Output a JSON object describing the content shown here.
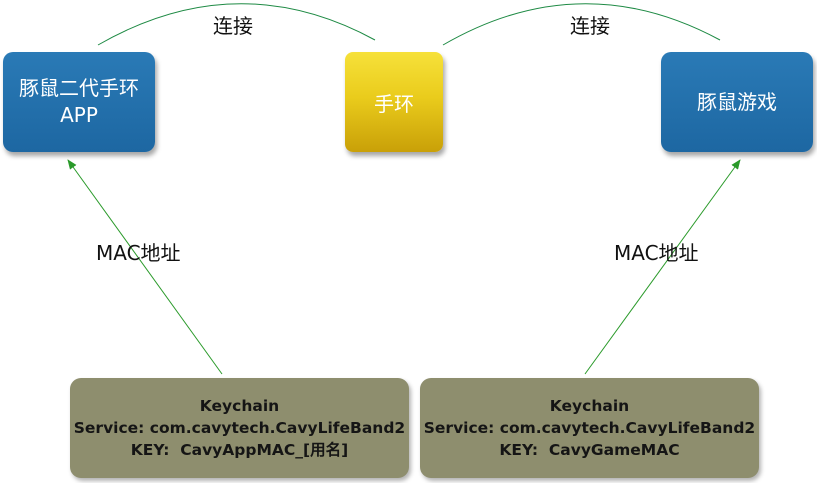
{
  "nodes": {
    "band_app": {
      "line1": "豚鼠二代手环",
      "line2": "APP"
    },
    "band": {
      "label": "手环"
    },
    "game": {
      "label": "豚鼠游戏"
    }
  },
  "edges": {
    "connect_left": "连接",
    "connect_right": "连接",
    "mac_left": "MAC地址",
    "mac_right": "MAC地址"
  },
  "keychains": {
    "left": {
      "title": "Keychain",
      "service": "Service: com.cavytech.CavyLifeBand2",
      "key": "KEY:  CavyAppMAC_[用名]"
    },
    "right": {
      "title": "Keychain",
      "service": "Service: com.cavytech.CavyLifeBand2",
      "key": "KEY:  CavyGameMAC"
    }
  },
  "colors": {
    "node_blue": "#1f6ea9",
    "node_gold": "#e8c71b",
    "keychain_bg": "#8e8e6e",
    "connect_line": "#1e8a44",
    "arrow_line": "#2a9a2a"
  }
}
